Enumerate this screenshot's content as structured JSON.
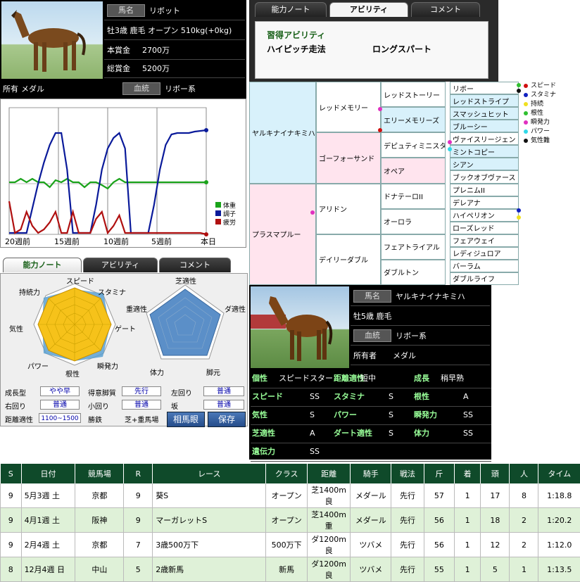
{
  "horse": {
    "name_tag": "馬名",
    "name": "リボット",
    "info": "牡3歳 鹿毛 オープン 510kg(+0kg)",
    "prize_label": "本賞金",
    "prize": "2700万",
    "total_label": "総賞金",
    "total": "5200万",
    "owner_label": "所有",
    "owner": "メダル",
    "blood_tag": "血統",
    "blood": "リボー系"
  },
  "chart_data": {
    "type": "line",
    "x_labels": [
      "20週前",
      "15週前",
      "10週前",
      "5週前",
      "本日"
    ],
    "series": [
      {
        "name": "体重",
        "color": "#1aa31a",
        "values": [
          258,
          258,
          253,
          258,
          253,
          258,
          258,
          265,
          255,
          258,
          253,
          258,
          258,
          265,
          258,
          258,
          262,
          267,
          258,
          253,
          258,
          258,
          258,
          258,
          258,
          258,
          258,
          258,
          258,
          258,
          258,
          258,
          258,
          258,
          258
        ]
      },
      {
        "name": "調子",
        "color": "#0a1a9a",
        "values": [
          330,
          330,
          330,
          330,
          295,
          260,
          230,
          205,
          188,
          188,
          240,
          330,
          330,
          330,
          330,
          290,
          240,
          210,
          195,
          188,
          210,
          330,
          330,
          330,
          330,
          290,
          240,
          205,
          190,
          188,
          188,
          188,
          186,
          185,
          184
        ]
      },
      {
        "name": "疲労",
        "color": "#b01010",
        "values": [
          285,
          330,
          325,
          300,
          320,
          330,
          325,
          315,
          300,
          330,
          330,
          300,
          330,
          330,
          330,
          310,
          300,
          330,
          320,
          305,
          330,
          330,
          330,
          330,
          330,
          330,
          330,
          330,
          330,
          330,
          330,
          330,
          330,
          330,
          332
        ]
      }
    ]
  },
  "top_tabs": [
    "能力ノート",
    "アビリティ",
    "コメント"
  ],
  "abilities": {
    "title": "習得アビリティ",
    "items": [
      "ハイピッチ走法",
      "ロングスパート"
    ]
  },
  "pedigree": {
    "g1": [
      "ヤルキナイナキミハ",
      "プラスマプルー"
    ],
    "g2": [
      "レッドメモリー",
      "ゴーフォーサンド",
      "アリドン",
      "デイリーダブル"
    ],
    "g3": [
      "レッドストーリー",
      "エリーメモリーズ",
      "デピュティミニスタ",
      "オペア",
      "ドナテーロII",
      "オーロラ",
      "フェアトライアル",
      "ダブルトン"
    ],
    "g4": [
      "リボー",
      "レッドストライプ",
      "スマッシュヒット",
      "ブルーシー",
      "ヴァイスリージェン",
      "ミントコピー",
      "シアン",
      "ブックオブヴァース",
      "プレニムII",
      "デレアナ",
      "ハイペリオン",
      "ローズレッド",
      "フェアウェイ",
      "レディジュロア",
      "バーラム",
      "ダブルライフ"
    ]
  },
  "legend": [
    {
      "label": "スピード",
      "color": "#d01010"
    },
    {
      "label": "スタミナ",
      "color": "#1020c0"
    },
    {
      "label": "持続",
      "color": "#f0e020"
    },
    {
      "label": "根性",
      "color": "#30c030"
    },
    {
      "label": "瞬発力",
      "color": "#e030c0"
    },
    {
      "label": "パワー",
      "color": "#30d8e8"
    },
    {
      "label": "気性難",
      "color": "#111111"
    }
  ],
  "note_tabs": [
    "能力ノート",
    "アビリティ",
    "コメント"
  ],
  "radar1": {
    "labels": [
      "スピード",
      "スタミナ",
      "ゲート",
      "瞬発力",
      "根性",
      "パワー",
      "気性",
      "持続力"
    ]
  },
  "radar2": {
    "labels": [
      "芝適性",
      "ダ適性",
      "脚元",
      "体力",
      "重適性"
    ]
  },
  "note_fields": {
    "growth_label": "成長型",
    "growth": "やや早",
    "leg_label": "得意脚質",
    "leg": "先行",
    "left_label": "左回り",
    "left": "普通",
    "right_label": "右回り",
    "right": "普通",
    "small_label": "小回り",
    "small": "普通",
    "slope_label": "坂",
    "slope": "普通",
    "dist_label": "距離適性",
    "dist": "1100~1500",
    "track_label": "勝鉄",
    "track": "芝+重馬場",
    "btn_eye": "相馬眼",
    "btn_save": "保存"
  },
  "partner": {
    "name_tag": "馬名",
    "name": "ヤルキナイナキミハ",
    "info": "牡5歳 鹿毛",
    "blood_tag": "血統",
    "blood": "リボー系",
    "owner_label": "所有者",
    "owner": "メダル",
    "rows": [
      [
        [
          "個性",
          "スピードスター"
        ],
        [
          "距離適性",
          "短中"
        ],
        [
          "成長",
          "稍早熟"
        ]
      ],
      [
        [
          "スピード",
          "SS"
        ],
        [
          "スタミナ",
          "S"
        ],
        [
          "根性",
          "A"
        ]
      ],
      [
        [
          "気性",
          "S"
        ],
        [
          "パワー",
          "S"
        ],
        [
          "瞬発力",
          "SS"
        ]
      ],
      [
        [
          "芝適性",
          "A"
        ],
        [
          "ダート適性",
          "S"
        ],
        [
          "体力",
          "SS"
        ]
      ],
      [
        [
          "遺伝力",
          "SS"
        ]
      ]
    ]
  },
  "race": {
    "headers": [
      "S",
      "日付",
      "競馬場",
      "R",
      "レース",
      "クラス",
      "距離",
      "騎手",
      "戦法",
      "斤",
      "着",
      "頭",
      "人",
      "タイム"
    ],
    "rows": [
      [
        "9",
        "5月3週 土",
        "京都",
        "9",
        "葵S",
        "オープン",
        "芝1400m良",
        "メダール",
        "先行",
        "57",
        "1",
        "17",
        "8",
        "1:18.8"
      ],
      [
        "9",
        "4月1週 土",
        "阪神",
        "9",
        "マーガレットS",
        "オープン",
        "芝1400m重",
        "メダール",
        "先行",
        "56",
        "1",
        "18",
        "2",
        "1:20.2"
      ],
      [
        "9",
        "2月4週 土",
        "京都",
        "7",
        "3歳500万下",
        "500万下",
        "ダ1200m良",
        "ツバメ",
        "先行",
        "56",
        "1",
        "12",
        "2",
        "1:12.0"
      ],
      [
        "8",
        "12月4週 日",
        "中山",
        "5",
        "2歳新馬",
        "新馬",
        "ダ1200m良",
        "ツバメ",
        "先行",
        "55",
        "1",
        "5",
        "1",
        "1:13.5"
      ]
    ]
  }
}
